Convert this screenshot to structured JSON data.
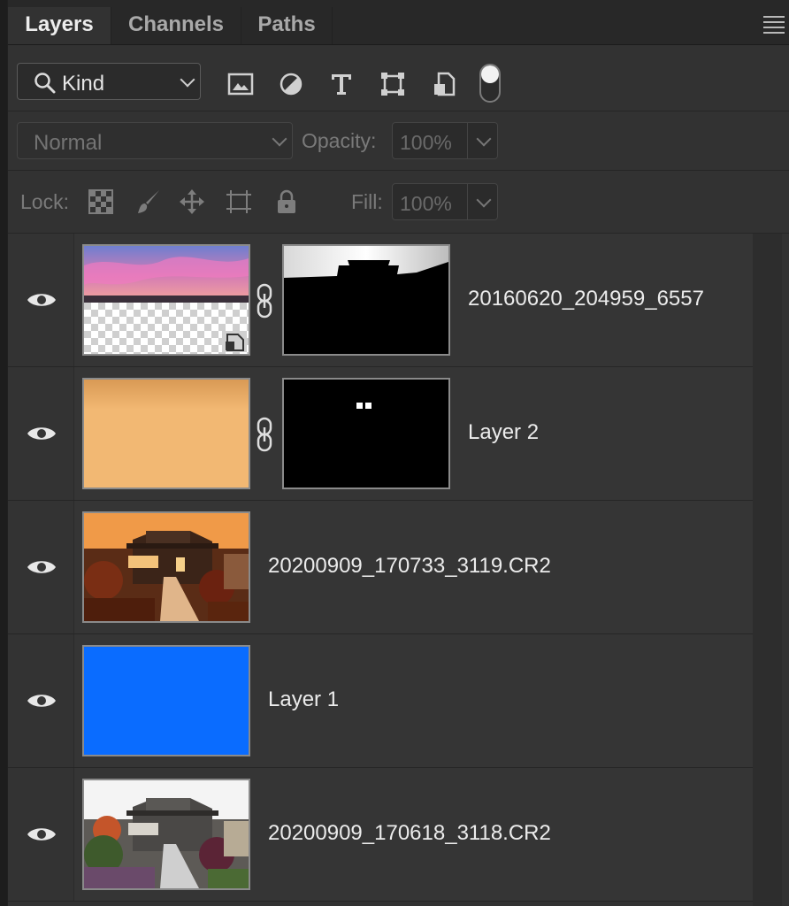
{
  "tabs": [
    {
      "label": "Layers",
      "active": true
    },
    {
      "label": "Channels",
      "active": false
    },
    {
      "label": "Paths",
      "active": false
    }
  ],
  "filter": {
    "kind_label": "Kind",
    "icons": [
      "image-filter-icon",
      "adjustment-filter-icon",
      "type-filter-icon",
      "shape-filter-icon",
      "smart-object-filter-icon",
      "filter-toggle-icon"
    ]
  },
  "blend": {
    "mode": "Normal",
    "opacity_label": "Opacity:",
    "opacity_value": "100%"
  },
  "lock": {
    "label": "Lock:",
    "icons": [
      "lock-transparency-icon",
      "lock-paint-icon",
      "lock-position-icon",
      "lock-artboard-icon",
      "lock-all-icon"
    ],
    "fill_label": "Fill:",
    "fill_value": "100%"
  },
  "layers": [
    {
      "name": "20160620_204959_6557",
      "thumb": "sky-sunset",
      "has_mask": true,
      "mask": "house-silhouette",
      "smart_object": true
    },
    {
      "name": "Layer 2",
      "thumb": "solid-peach",
      "color": "#f2b873",
      "has_mask": true,
      "mask": "tiny-white-dots"
    },
    {
      "name": "20200909_170733_3119.CR2",
      "thumb": "house-orange",
      "has_mask": false
    },
    {
      "name": "Layer 1",
      "thumb": "solid-blue",
      "color": "#0a6cff",
      "has_mask": false
    },
    {
      "name": "20200909_170618_3118.CR2",
      "thumb": "house-natural",
      "has_mask": false
    }
  ]
}
